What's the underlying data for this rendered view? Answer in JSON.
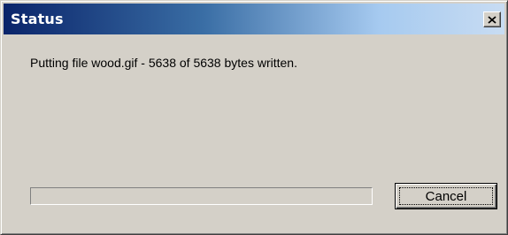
{
  "window": {
    "title": "Status",
    "close_icon": "close-icon"
  },
  "message": "Putting file wood.gif - 5638 of 5638 bytes written.",
  "progress": {
    "fraction": 0
  },
  "buttons": {
    "cancel_label": "Cancel"
  }
}
